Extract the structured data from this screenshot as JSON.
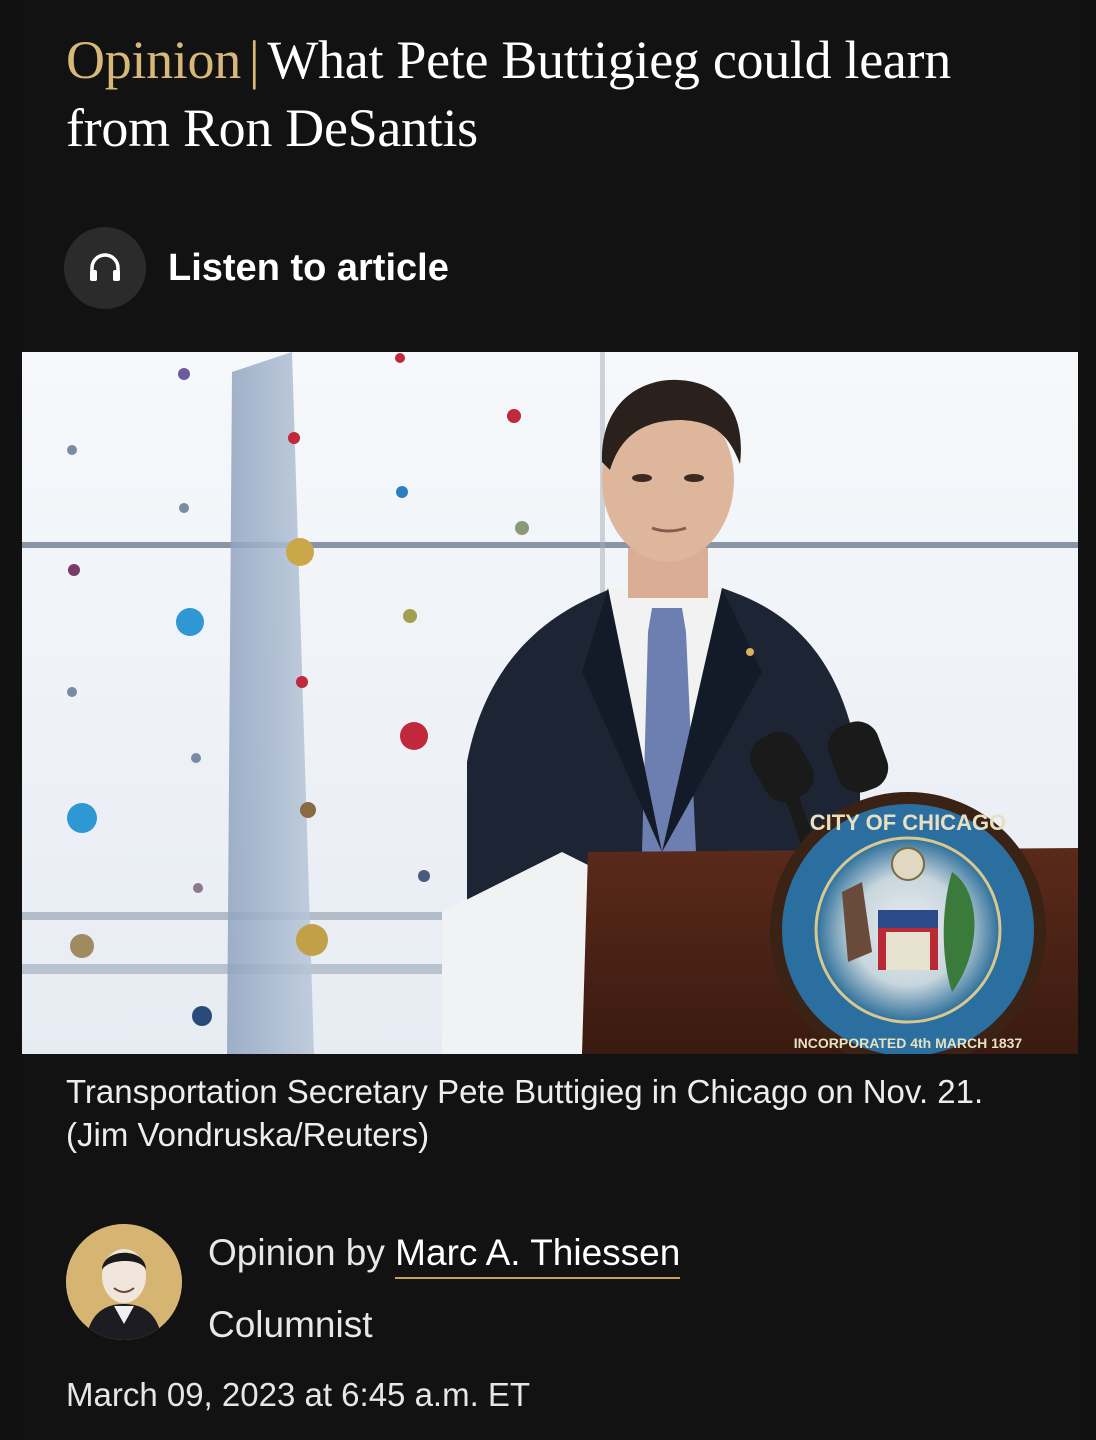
{
  "article": {
    "kicker": "Opinion",
    "separator": "|",
    "title": "What Pete Buttigieg could learn from Ron DeSantis",
    "listen_label": "Listen to article",
    "listen_icon": "headphones-icon",
    "photo_caption": "Transportation Secretary Pete Buttigieg in Chicago on Nov. 21. (Jim Vondruska/Reuters)",
    "seal_text_top": "CITY OF CHICAGO",
    "seal_text_bottom": "INCORPORATED 4th MARCH 1837",
    "byline_prefix": "Opinion by",
    "author": "Marc A. Thiessen",
    "role": "Columnist",
    "date": "March 09, 2023 at 6:45 a.m. ET"
  },
  "colors": {
    "background": "#121212",
    "kicker": "#d8b878",
    "author_underline": "#c9a15a",
    "avatar_ring": "#d6b472"
  }
}
